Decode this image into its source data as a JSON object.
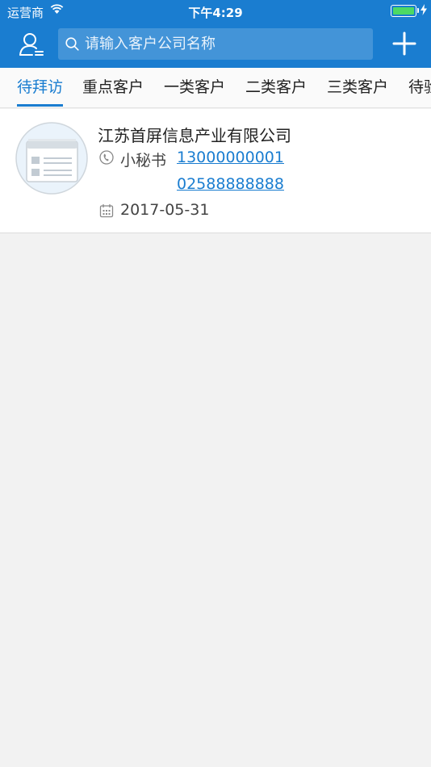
{
  "status_bar": {
    "carrier": "运营商",
    "time": "下午4:29"
  },
  "header": {
    "search_placeholder": "请输入客户公司名称",
    "profile_icon": "user-menu-icon",
    "add_icon": "plus-icon"
  },
  "tabs": [
    {
      "label": "待拜访",
      "active": true
    },
    {
      "label": "重点客户",
      "active": false
    },
    {
      "label": "一类客户",
      "active": false
    },
    {
      "label": "二类客户",
      "active": false
    },
    {
      "label": "三类客户",
      "active": false
    },
    {
      "label": "待验",
      "active": false
    }
  ],
  "customers": [
    {
      "company": "江苏首屏信息产业有限公司",
      "contact": "小秘书",
      "phones": [
        "13000000001",
        "02588888888"
      ],
      "date": "2017-05-31"
    }
  ],
  "colors": {
    "primary": "#1a7dd0",
    "background": "#f2f2f2",
    "battery": "#4cd964"
  }
}
